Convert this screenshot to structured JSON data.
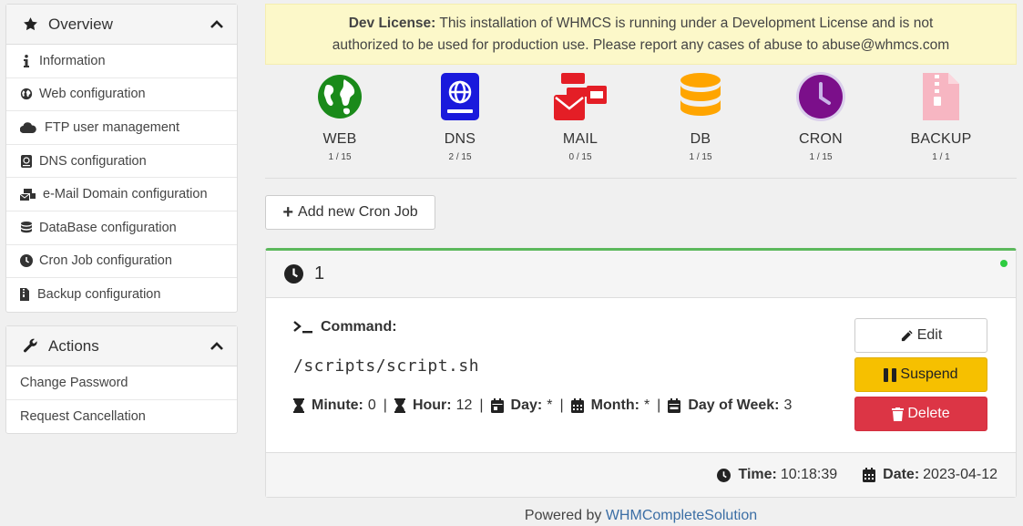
{
  "sidebar": {
    "overview": {
      "title": "Overview",
      "items": [
        {
          "label": "Information",
          "icon": "info-icon"
        },
        {
          "label": "Web configuration",
          "icon": "globe-icon"
        },
        {
          "label": "FTP user management",
          "icon": "cloud-icon"
        },
        {
          "label": "DNS configuration",
          "icon": "address-book-icon"
        },
        {
          "label": "e-Mail Domain configuration",
          "icon": "mail-bulk-icon"
        },
        {
          "label": "DataBase configuration",
          "icon": "database-icon"
        },
        {
          "label": "Cron Job configuration",
          "icon": "clock-icon"
        },
        {
          "label": "Backup configuration",
          "icon": "file-archive-icon"
        }
      ]
    },
    "actions": {
      "title": "Actions",
      "items": [
        {
          "label": "Change Password"
        },
        {
          "label": "Request Cancellation"
        }
      ]
    }
  },
  "alert": {
    "strong": "Dev License:",
    "line1": " This installation of WHMCS is running under a Development License and is not",
    "line2": "authorized to be used for production use. Please report any cases of abuse to abuse@whmcs.com"
  },
  "stats": [
    {
      "label": "WEB",
      "count": "1 / 15",
      "icon": "globe-icon",
      "color": "#1a8a1a"
    },
    {
      "label": "DNS",
      "count": "2 / 15",
      "icon": "address-book-icon",
      "color": "#1a1adc"
    },
    {
      "label": "MAIL",
      "count": "0 / 15",
      "icon": "mail-bulk-icon",
      "color": "#e41e26"
    },
    {
      "label": "DB",
      "count": "1 / 15",
      "icon": "database-icon",
      "color": "#ffa500"
    },
    {
      "label": "CRON",
      "count": "1 / 15",
      "icon": "clock-icon",
      "color": "#7b0f8a"
    },
    {
      "label": "BACKUP",
      "count": "1 / 1",
      "icon": "file-archive-icon",
      "color": "#f7b6c2"
    }
  ],
  "add_button": "Add new Cron Job",
  "cron": {
    "id": "1",
    "command_label": "Command:",
    "command": "/scripts/script.sh",
    "minute_label": "Minute:",
    "minute": "0",
    "hour_label": "Hour:",
    "hour": "12",
    "day_label": "Day:",
    "day": "*",
    "month_label": "Month:",
    "month": "*",
    "dow_label": "Day of Week:",
    "dow": "3",
    "edit": "Edit",
    "suspend": "Suspend",
    "delete": "Delete",
    "time_label": "Time:",
    "time": "10:18:39",
    "date_label": "Date:",
    "date": "2023-04-12",
    "status_color": "#2ecc40"
  },
  "footer": {
    "powered_by": "Powered by ",
    "link": "WHMCompleteSolution"
  }
}
